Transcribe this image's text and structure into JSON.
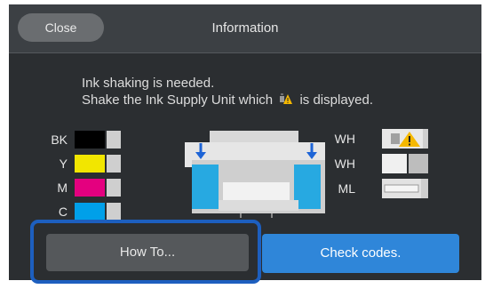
{
  "header": {
    "close_label": "Close",
    "title": "Information"
  },
  "message": {
    "line1": "Ink shaking is needed.",
    "line2_before": "Shake the Ink Supply Unit which",
    "line2_after": "is displayed.",
    "inline_icon": "shake-warning-icon"
  },
  "inks": [
    {
      "label": "BK",
      "color": "#000000"
    },
    {
      "label": "Y",
      "color": "#f2e600"
    },
    {
      "label": "M",
      "color": "#e4007f"
    },
    {
      "label": "C",
      "color": "#00a0e9"
    }
  ],
  "white_inks": [
    {
      "label": "WH",
      "icon": "shake-warning-icon"
    },
    {
      "label": "WH",
      "icon": ""
    },
    {
      "label": "ML",
      "icon": ""
    }
  ],
  "buttons": {
    "how_to": "How To...",
    "check_codes": "Check codes."
  },
  "colors": {
    "accent": "#2f86d9",
    "highlight": "#1d5fbf",
    "background": "#2b2e31"
  }
}
